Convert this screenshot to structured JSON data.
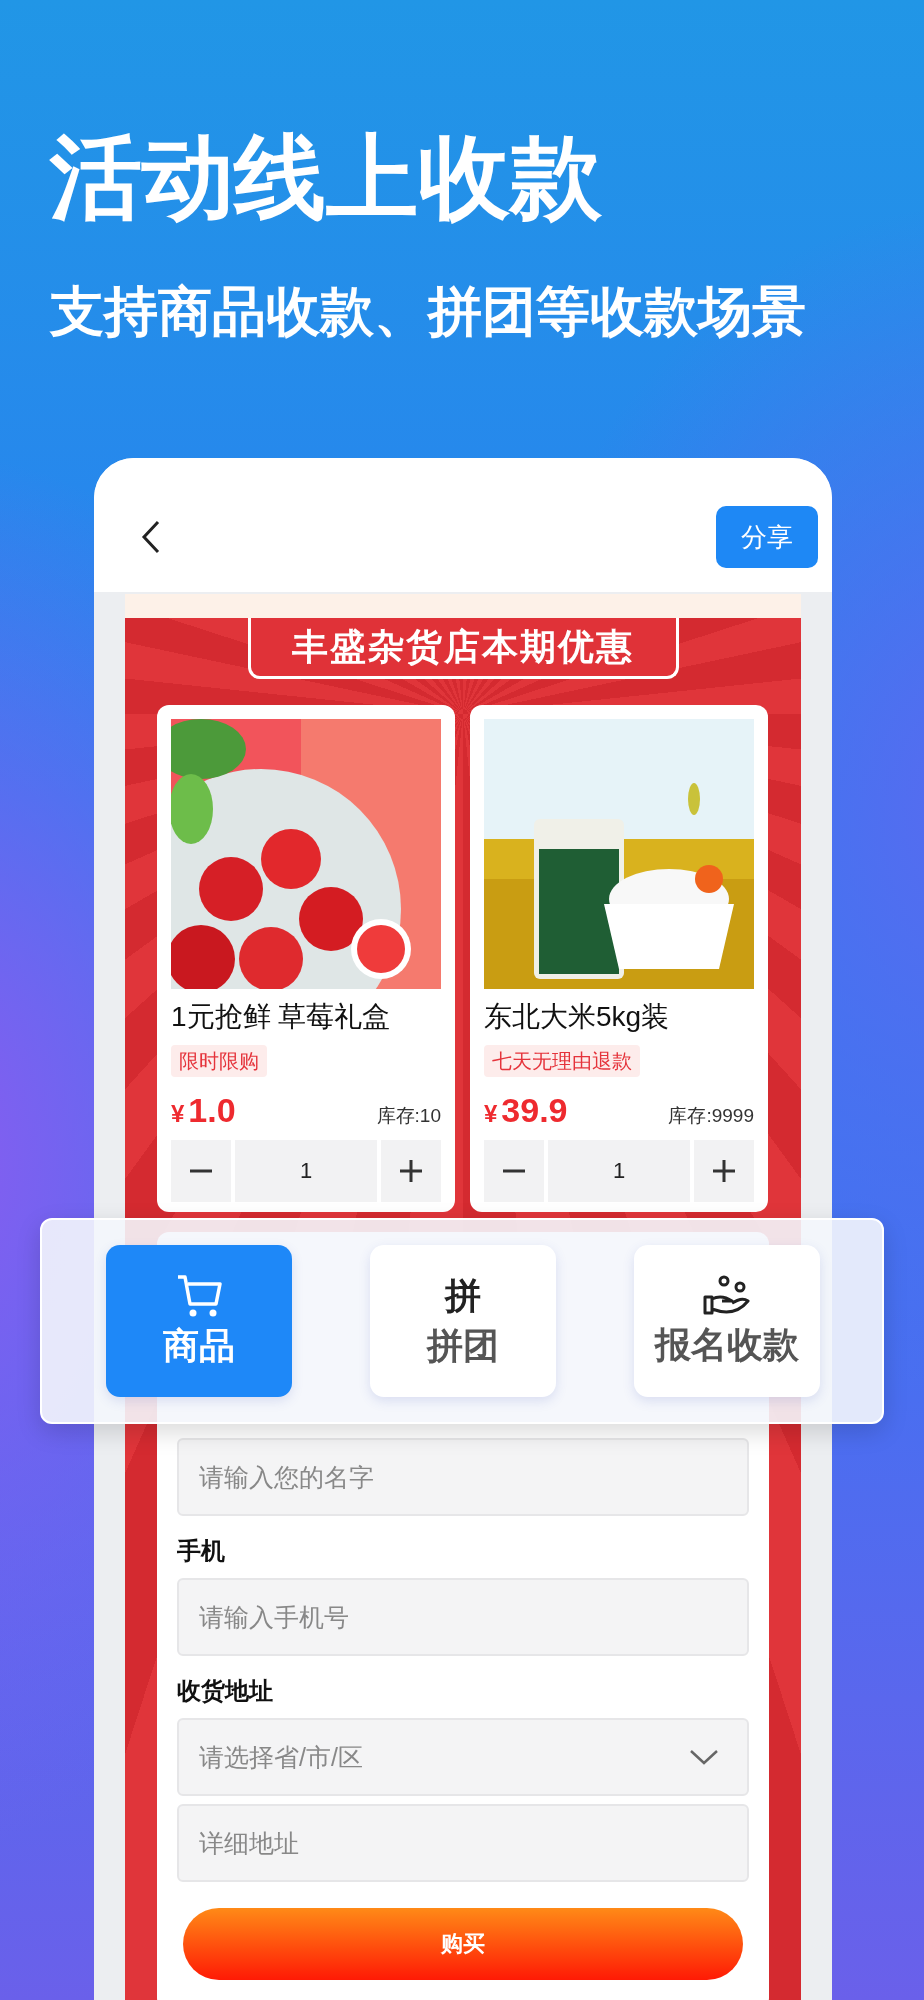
{
  "headline": "活动线上收款",
  "subheadline": "支持商品收款、拼团等收款场景",
  "header": {
    "share": "分享"
  },
  "banner": {
    "title": "丰盛杂货店本期优惠"
  },
  "products": [
    {
      "name": "1元抢鲜 草莓礼盒",
      "tag": "限时限购",
      "currency": "¥",
      "price": "1.0",
      "stock": "库存:10",
      "quantity": "1"
    },
    {
      "name": "东北大米5kg装",
      "tag": "七天无理由退款",
      "currency": "¥",
      "price": "39.9",
      "stock": "库存:9999",
      "quantity": "1"
    }
  ],
  "form": {
    "fields": [
      {
        "placeholder": "请输入您的名字",
        "kind": "text"
      },
      {
        "label": "手机",
        "placeholder": "请输入手机号",
        "kind": "text"
      },
      {
        "label": "收货地址",
        "placeholder": "请选择省/市/区",
        "kind": "select"
      },
      {
        "placeholder": "详细地址",
        "kind": "text"
      }
    ],
    "submit": "购买"
  },
  "tabs": [
    {
      "label": "商品",
      "kind": "cart",
      "selected": true
    },
    {
      "label": "拼团",
      "kind": "glyph",
      "glyph": "拼",
      "selected": false
    },
    {
      "label": "报名收款",
      "kind": "hand",
      "selected": false
    }
  ]
}
